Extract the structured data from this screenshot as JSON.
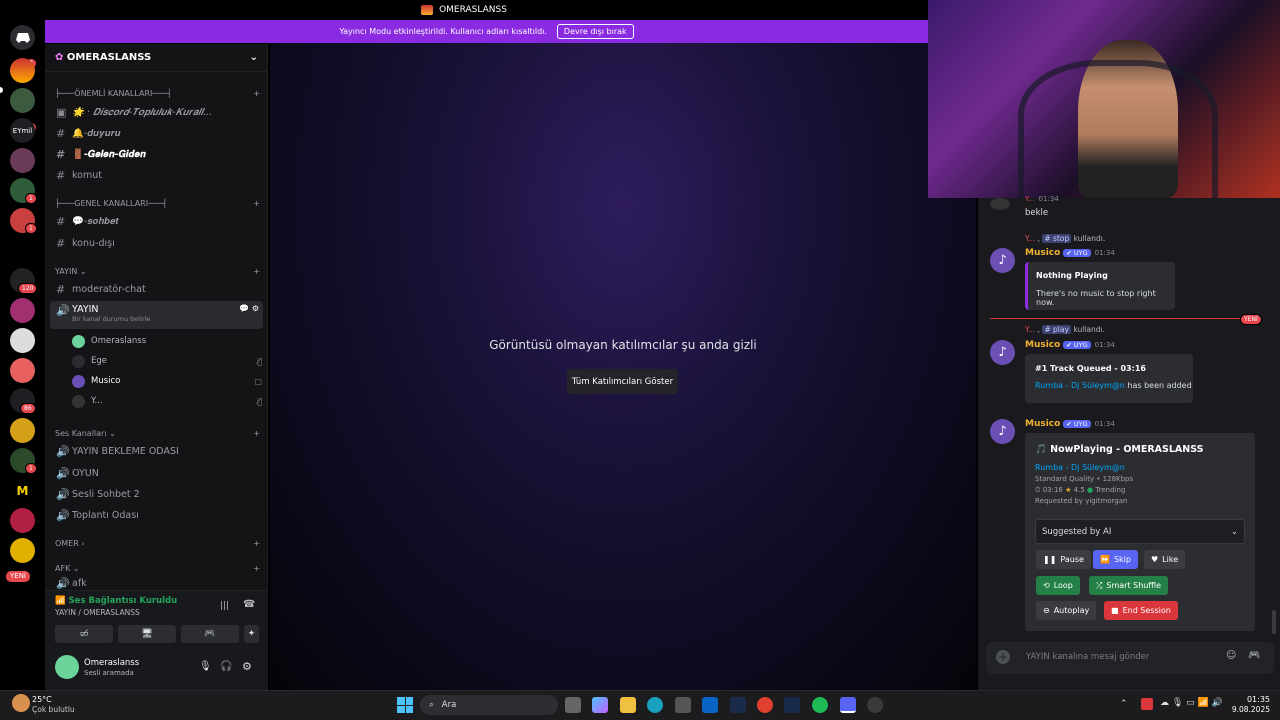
{
  "window": {
    "title": "OMERASLANSS"
  },
  "rail": {
    "badges": [
      "3",
      "2",
      "1",
      "1",
      "120",
      "86",
      "1"
    ],
    "label_eymi": "EYmil",
    "new_badge": "YENİ"
  },
  "streamer_banner": {
    "text": "Yayıncı Modu etkinleştirildi. Kullanıcı adları kısaltıldı.",
    "button": "Devre dışı bırak"
  },
  "server": {
    "name": "OMERASLANSS"
  },
  "categories": {
    "important": "├───ÖNEMLİ KANALLARI───┤",
    "general": "├───GENEL KANALLARI───┤",
    "yayin": "YAYIN",
    "voice": "Ses Kanalları",
    "omer": "OMER",
    "afk": "AFK"
  },
  "channels": {
    "rules": "🌟 · 𝑫𝒊𝒔𝒄𝒐𝒓𝒅-𝑻𝒐𝒑𝒍𝒖𝒍𝒖𝒌-𝑲𝒖𝒓𝒂𝒍𝒍...",
    "duyuru": "🔔-𝒅𝒖𝒚𝒖𝒓𝒖",
    "gelen": "🚪-𝑮𝒆𝒍𝒆𝒏-𝑮𝒊𝒅𝒆𝒏",
    "komut": "komut",
    "sohbet": "💬-𝒔𝒐𝒉𝒃𝒆𝒕",
    "konu": "konu-dışı",
    "mod": "moderatör-chat",
    "yayin_voice": "YAYIN",
    "yayin_status": "Bir kanal durumu belirle",
    "bekleme": "YAYIN BEKLEME ODASI",
    "oyun": "OYUN",
    "sesli2": "Sesli Sohbet 2",
    "toplanti": "Toplantı Odası",
    "afk": "afk"
  },
  "voice_users": [
    "Omeraslanss",
    "Ege",
    "Musico",
    "Y..."
  ],
  "voice_panel": {
    "status": "Ses Bağlantısı Kuruldu",
    "location": "YAYIN / OMERASLANSS",
    "username": "Omeraslanss",
    "substatus": "Sesli aramada"
  },
  "stage": {
    "message": "Görüntüsü olmayan katılımcılar şu anda gizli",
    "button": "Tüm Katılımcıları Göster"
  },
  "chat": {
    "m0_name": "Y...",
    "m0_time": "01:34",
    "m0_text": "bekle",
    "cmd1_user": "Y...",
    "cmd1_cmd": "stop",
    "cmd1_used": "kullandı.",
    "bot_name": "Musico",
    "bot_tag": "✔ UYG",
    "t1": "01:34",
    "e1_title": "Nothing Playing",
    "e1_text": "There's no music to stop right now.",
    "new_label": "YENİ",
    "cmd2_user": "Y...",
    "cmd2_cmd": "play",
    "cmd2_used": "kullandı.",
    "t2": "01:34",
    "e2_title": "#1 Track Queued - 03:16",
    "e2_link": "Rumba - Dj Süleym@n",
    "e2_text": "has been added",
    "t3": "01:34",
    "np_title": "NowPlaying - OMERASLANSS",
    "np_track": "Rumba - Dj Süleym@n",
    "np_quality": "Standard Quality • 128Kbps",
    "np_time": "03:16",
    "np_rating": "4.5",
    "np_trending": "Trending",
    "np_req": "Requested by yigitmorgan",
    "np_select": "Suggested by AI",
    "b_pause": "Pause",
    "b_skip": "Skip",
    "b_like": "Like",
    "b_loop": "Loop",
    "b_shuffle": "Smart Shuffle",
    "b_autoplay": "Autoplay",
    "b_end": "End Session",
    "input_placeholder": "YAYIN kanalına mesaj gönder"
  },
  "taskbar": {
    "temp": "25°C",
    "weather": "Çok bulutlu",
    "search": "Ara",
    "time": "01:35",
    "date": "9.08.2025"
  },
  "colors": {
    "accent": "#5865f2",
    "streamer": "#8a2be2",
    "green": "#23a55a",
    "red": "#da373c"
  }
}
